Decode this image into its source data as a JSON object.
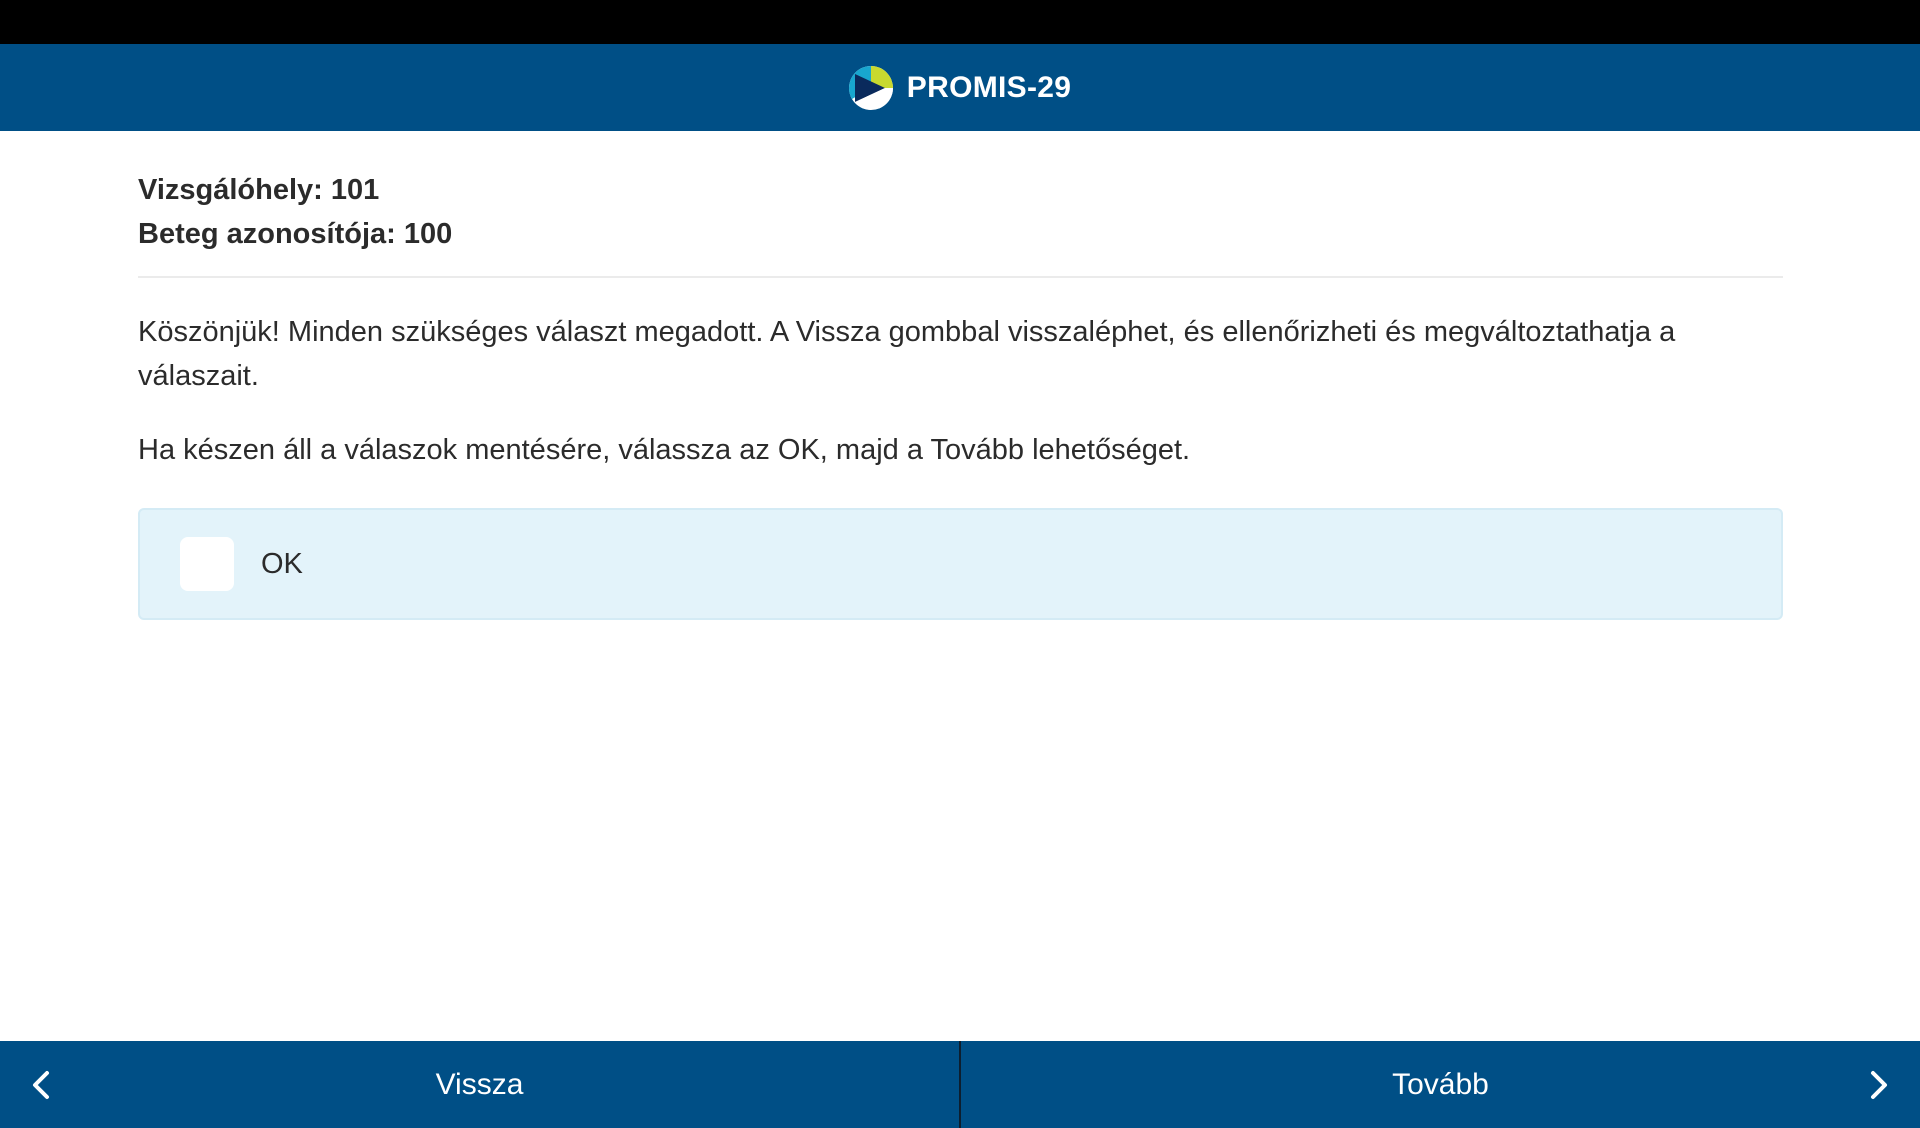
{
  "header": {
    "title": "PROMIS-29",
    "logo_icon": "promis-logo-icon"
  },
  "meta": {
    "site": "Vizsgálóhely: 101",
    "patient": "Beteg azonosítója: 100"
  },
  "body": {
    "paragraph1": "Köszönjük! Minden szükséges választ megadott. A Vissza gombbal visszaléphet, és ellenőrizheti és megváltoztathatja a válaszait.",
    "paragraph2": "Ha készen áll a válaszok mentésére, válassza az OK, majd a Tovább lehetőséget."
  },
  "option": {
    "label": "OK",
    "checked": false
  },
  "nav": {
    "back_label": "Vissza",
    "next_label": "Tovább"
  },
  "colors": {
    "header_bg": "#004f86",
    "option_bg": "#e3f3fa",
    "logo_yellow": "#c8d92f",
    "logo_teal": "#18a6cf",
    "logo_navy": "#0a2a5c"
  }
}
